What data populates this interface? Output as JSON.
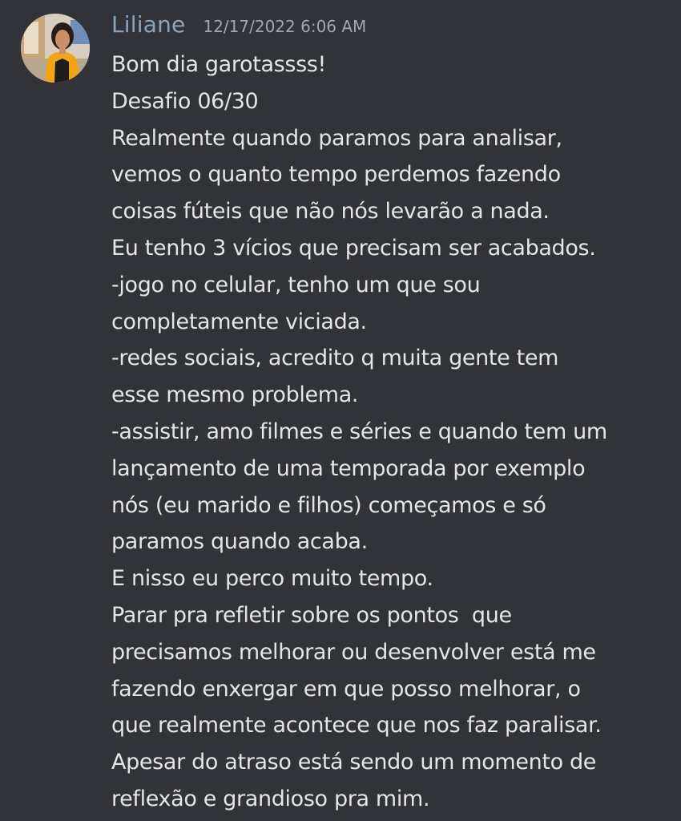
{
  "message": {
    "avatar_icon": "user-avatar-photo",
    "author": "Liliane",
    "timestamp": "12/17/2022 6:06 AM",
    "colors": {
      "background": "#313338",
      "author": "#8fa3b8",
      "timestamp": "#a3a7ad",
      "text": "#e4e5e8"
    },
    "lines": [
      "Bom dia garotassss!",
      "Desafio 06/30",
      "Realmente quando paramos para analisar,",
      "vemos o quanto tempo perdemos fazendo",
      "coisas fúteis que não nós levarão a nada.",
      "Eu tenho 3 vícios que precisam ser acabados.",
      "-jogo no celular, tenho um que sou",
      "completamente viciada.",
      "-redes sociais, acredito q muita gente tem",
      "esse mesmo problema.",
      "-assistir, amo filmes e séries e quando tem um",
      "lançamento de uma temporada por exemplo",
      "nós (eu marido e filhos) começamos e só",
      "paramos quando acaba.",
      "E nisso eu perco muito tempo.",
      "Parar pra refletir sobre os pontos  que",
      "precisamos melhorar ou desenvolver está me",
      "fazendo enxergar em que posso melhorar, o",
      "que realmente acontece que nos faz paralisar.",
      "Apesar do atraso está sendo um momento de",
      "reflexão e grandioso pra mim."
    ]
  }
}
